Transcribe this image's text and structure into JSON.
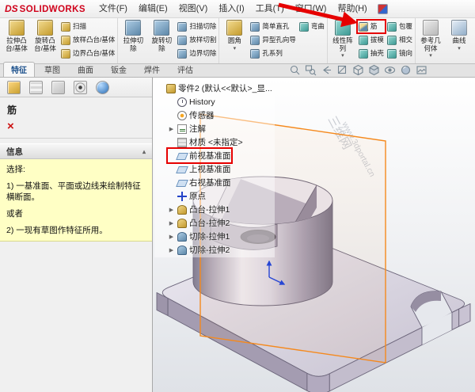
{
  "title_bar": {
    "logo_mark": "DS",
    "logo_text": "SOLIDWORKS",
    "menus": [
      "文件(F)",
      "编辑(E)",
      "视图(V)",
      "插入(I)",
      "工具(T)",
      "窗口(W)",
      "帮助(H)"
    ]
  },
  "ribbon": {
    "caret_glyph": "▾",
    "groups": [
      {
        "columns": [
          {
            "type": "large",
            "name": "extruded-boss-base",
            "icon": "gold",
            "label": "拉伸凸\n台/基体"
          },
          {
            "type": "large",
            "name": "revolved-boss-base",
            "icon": "gold",
            "label": "旋转凸\n台/基体"
          },
          {
            "type": "stack",
            "buttons": [
              {
                "name": "swept-boss-base",
                "icon": "gold",
                "label": "扫描"
              },
              {
                "name": "lofted-boss-base",
                "icon": "gold",
                "label": "放样凸台/基体"
              },
              {
                "name": "boundary-boss-base",
                "icon": "gold",
                "label": "边界凸台/基体"
              }
            ]
          }
        ]
      },
      {
        "columns": [
          {
            "type": "large",
            "name": "extruded-cut",
            "icon": "cut",
            "label": "拉伸切\n除"
          },
          {
            "type": "large",
            "name": "revolved-cut",
            "icon": "cut",
            "label": "旋转切\n除"
          },
          {
            "type": "stack",
            "buttons": [
              {
                "name": "swept-cut",
                "icon": "cut",
                "label": "扫描切除"
              },
              {
                "name": "lofted-cut",
                "icon": "cut",
                "label": "放样切割"
              },
              {
                "name": "boundary-cut",
                "icon": "cut",
                "label": "边界切除"
              }
            ]
          }
        ]
      },
      {
        "columns": [
          {
            "type": "large",
            "name": "fillet",
            "icon": "gold",
            "label": "圆角",
            "caret": true
          },
          {
            "type": "stack",
            "buttons": [
              {
                "name": "simple-hole",
                "icon": "cut",
                "label": "简单直孔"
              },
              {
                "name": "hole-wizard",
                "icon": "cut",
                "label": "异型孔向导"
              },
              {
                "name": "hole-series",
                "icon": "cut",
                "label": "孔系列"
              }
            ]
          },
          {
            "type": "stack",
            "buttons": [
              {
                "name": "flex",
                "icon": "teal",
                "label": "弯曲"
              }
            ]
          }
        ]
      },
      {
        "columns": [
          {
            "type": "large",
            "name": "linear-pattern",
            "icon": "teal",
            "label": "线性阵\n列",
            "caret": true
          },
          {
            "type": "stack",
            "buttons": [
              {
                "name": "rib",
                "icon": "mix",
                "label": "筋",
                "highlight": true
              },
              {
                "name": "draft",
                "icon": "teal",
                "label": "拔模"
              },
              {
                "name": "shell",
                "icon": "teal",
                "label": "抽壳"
              }
            ]
          },
          {
            "type": "stack",
            "buttons": [
              {
                "name": "wrap",
                "icon": "teal",
                "label": "包覆"
              },
              {
                "name": "intersect",
                "icon": "teal",
                "label": "相交"
              },
              {
                "name": "mirror",
                "icon": "teal",
                "label": "镜向"
              }
            ]
          }
        ]
      },
      {
        "columns": [
          {
            "type": "large",
            "name": "reference-geometry",
            "icon": "ref",
            "label": "参考几\n何体",
            "caret": true
          },
          {
            "type": "large",
            "name": "curves",
            "icon": "curve",
            "label": "曲线",
            "caret": true
          }
        ]
      }
    ]
  },
  "tabs": {
    "items": [
      "特征",
      "草图",
      "曲面",
      "钣金",
      "焊件",
      "评估"
    ],
    "active_index": 0
  },
  "property_manager": {
    "tab_icons": [
      "propertymanager-tab",
      "configurationmanager-tab",
      "dimxpertmanager-tab",
      "displaymanager-tab",
      "appearances-tab"
    ],
    "title": "筋",
    "cancel_glyph": "×",
    "section_header": "信息",
    "collapse_glyph": "▴",
    "message_lines": [
      "选择:",
      "1) 一基准面、平面或边线来绘制特征横断面。",
      "或者",
      "2) 一现有草图作特征所用。"
    ]
  },
  "feature_tree": {
    "expand_glyph": "▶",
    "root": {
      "label": "零件2 (默认<<默认>_显...",
      "icon": "part"
    },
    "items": [
      {
        "label": "History",
        "icon": "history"
      },
      {
        "label": "传感器",
        "icon": "sensors"
      },
      {
        "label": "注解",
        "icon": "annot",
        "expand": true
      },
      {
        "label": "材质 <未指定>",
        "icon": "material"
      },
      {
        "label": "前视基准面",
        "icon": "plane",
        "highlight": true
      },
      {
        "label": "上视基准面",
        "icon": "plane"
      },
      {
        "label": "右视基准面",
        "icon": "plane"
      },
      {
        "label": "原点",
        "icon": "origin"
      },
      {
        "label": "凸台-拉伸1",
        "icon": "boss",
        "expand": true
      },
      {
        "label": "凸台-拉伸2",
        "icon": "boss",
        "expand": true
      },
      {
        "label": "切除-拉伸1",
        "icon": "cutex",
        "expand": true
      },
      {
        "label": "切除-拉伸2",
        "icon": "cutex",
        "expand": true
      }
    ]
  },
  "graphics": {
    "watermark_line1": "三维网",
    "watermark_line2": "www.3dportal.cn",
    "hud_icons": [
      "zoom-fit",
      "zoom-area",
      "previous-view",
      "section-view",
      "view-orientation",
      "display-style",
      "hide-show-items",
      "edit-appearance",
      "apply-scene"
    ]
  },
  "annotation": {
    "arrow_color": "#e60000"
  }
}
